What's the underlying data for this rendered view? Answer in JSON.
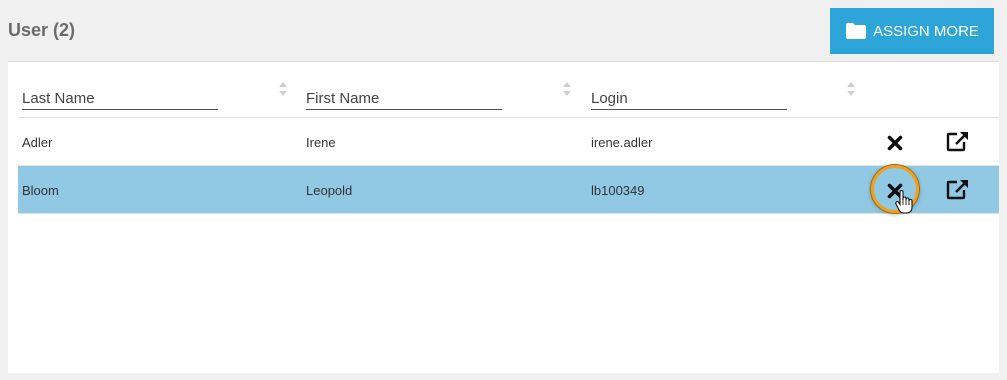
{
  "header": {
    "title": "User (2)",
    "assign_button_label": "ASSIGN MORE"
  },
  "table": {
    "columns": [
      {
        "label": "Last Name"
      },
      {
        "label": "First Name"
      },
      {
        "label": "Login"
      }
    ],
    "rows": [
      {
        "last_name": "Adler",
        "first_name": "Irene",
        "login": "irene.adler",
        "selected": false
      },
      {
        "last_name": "Bloom",
        "first_name": "Leopold",
        "login": "lb100349",
        "selected": true
      }
    ]
  },
  "colors": {
    "accent": "#2ea5d8",
    "selected_row": "#91c8e4",
    "highlight_ring": "#f0a020"
  },
  "icons": {
    "assign": "folder-icon",
    "remove": "close-icon",
    "open": "external-link-icon",
    "sort": "sort-icon"
  }
}
